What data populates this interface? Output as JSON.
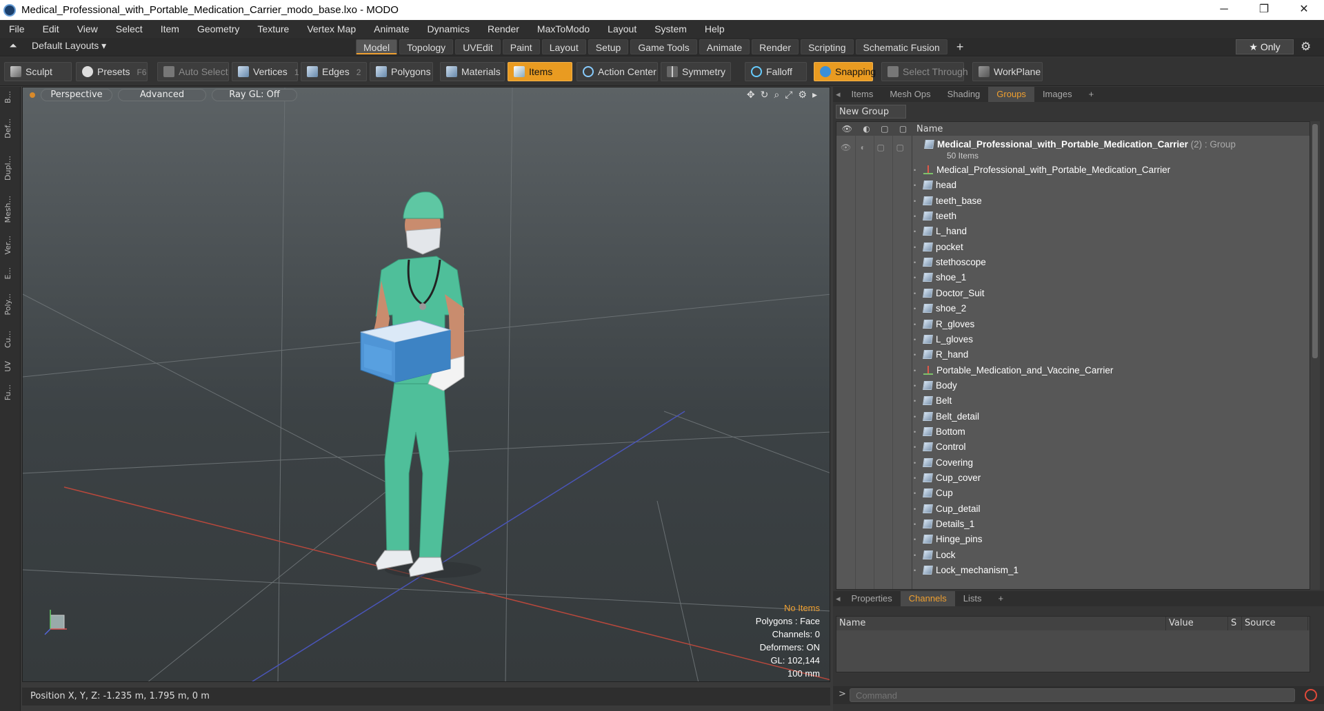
{
  "window": {
    "title": "Medical_Professional_with_Portable_Medication_Carrier_modo_base.lxo - MODO",
    "minimize": "─",
    "restore": "❐",
    "close": "✕"
  },
  "menu": [
    "File",
    "Edit",
    "View",
    "Select",
    "Item",
    "Geometry",
    "Texture",
    "Vertex Map",
    "Animate",
    "Dynamics",
    "Render",
    "MaxToModo",
    "Layout",
    "System",
    "Help"
  ],
  "layoutbar": {
    "default_layouts": "Default Layouts ▾",
    "tabs": [
      "Model",
      "Topology",
      "UVEdit",
      "Paint",
      "Layout",
      "Setup",
      "Game Tools",
      "Animate",
      "Render",
      "Scripting",
      "Schematic Fusion"
    ],
    "active_tab": "Model",
    "plus": "+",
    "only": "★  Only"
  },
  "toolbar": {
    "sculpt": "Sculpt",
    "presets": "Presets",
    "presets_key": "F6",
    "auto_select": "Auto Select",
    "vertices": "Vertices",
    "vertices_num": "1",
    "edges": "Edges",
    "edges_num": "2",
    "polygons": "Polygons",
    "materials": "Materials",
    "items": "Items",
    "action_center": "Action Center",
    "symmetry": "Symmetry",
    "falloff": "Falloff",
    "snapping": "Snapping",
    "select_through": "Select Through",
    "workplane": "WorkPlane"
  },
  "leftstrip": [
    "B...",
    "Def...",
    "Dupl...",
    "Mesh...",
    "Ver...",
    "E...",
    "Poly...",
    "Cu...",
    "UV",
    "Fu..."
  ],
  "viewport": {
    "perspective": "Perspective",
    "advanced": "Advanced",
    "raygl": "Ray GL: Off",
    "stats": [
      "No Items",
      "Polygons : Face",
      "Channels: 0",
      "Deformers: ON",
      "GL: 102,144",
      "100 mm"
    ]
  },
  "status": "Position X, Y, Z:   -1.235 m, 1.795 m, 0 m",
  "rpanel": {
    "tabs": [
      "Items",
      "Mesh Ops",
      "Shading",
      "Groups",
      "Images",
      "+"
    ],
    "active_tab": "Groups",
    "new_group": "New Group",
    "name_col": "Name",
    "group_name": "Medical_Professional_with_Portable_Medication_Carrier",
    "group_suffix": "(2) : Group",
    "group_count": "50 Items",
    "items": [
      {
        "name": "Medical_Professional_with_Portable_Medication_Carrier",
        "type": "locator"
      },
      {
        "name": "head",
        "type": "mesh"
      },
      {
        "name": "teeth_base",
        "type": "mesh"
      },
      {
        "name": "teeth",
        "type": "mesh"
      },
      {
        "name": "L_hand",
        "type": "mesh"
      },
      {
        "name": "pocket",
        "type": "mesh"
      },
      {
        "name": "stethoscope",
        "type": "mesh"
      },
      {
        "name": "shoe_1",
        "type": "mesh"
      },
      {
        "name": "Doctor_Suit",
        "type": "mesh"
      },
      {
        "name": "shoe_2",
        "type": "mesh"
      },
      {
        "name": "R_gloves",
        "type": "mesh"
      },
      {
        "name": "L_gloves",
        "type": "mesh"
      },
      {
        "name": "R_hand",
        "type": "mesh"
      },
      {
        "name": "Portable_Medication_and_Vaccine_Carrier",
        "type": "locator"
      },
      {
        "name": "Body",
        "type": "mesh"
      },
      {
        "name": "Belt",
        "type": "mesh"
      },
      {
        "name": "Belt_detail",
        "type": "mesh"
      },
      {
        "name": "Bottom",
        "type": "mesh"
      },
      {
        "name": "Control",
        "type": "mesh"
      },
      {
        "name": "Covering",
        "type": "mesh"
      },
      {
        "name": "Cup_cover",
        "type": "mesh"
      },
      {
        "name": "Cup",
        "type": "mesh"
      },
      {
        "name": "Cup_detail",
        "type": "mesh"
      },
      {
        "name": "Details_1",
        "type": "mesh"
      },
      {
        "name": "Hinge_pins",
        "type": "mesh"
      },
      {
        "name": "Lock",
        "type": "mesh"
      },
      {
        "name": "Lock_mechanism_1",
        "type": "mesh"
      }
    ],
    "ptabs": [
      "Properties",
      "Channels",
      "Lists",
      "+"
    ],
    "active_ptab": "Channels",
    "chan_cols": [
      "Name",
      "Value",
      "S",
      "Source"
    ],
    "command_placeholder": "Command",
    "command_arrow": ">"
  },
  "colors": {
    "accent": "#f0a030",
    "scrubs": "#4fbf9a",
    "carrier": "#4f95d6"
  }
}
